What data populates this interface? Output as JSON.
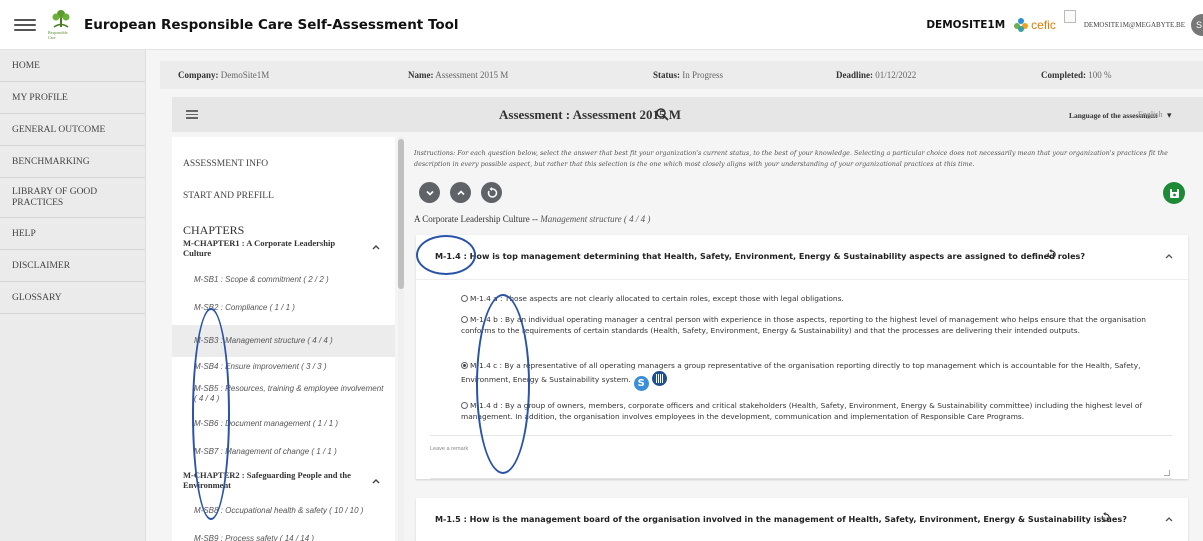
{
  "header": {
    "app_title": "European Responsible Care Self-Assessment Tool",
    "logo_caption": "Responsible Care",
    "site": "DEMOSITE1M",
    "partner_logo": "cefic",
    "email": "DEMOSITE1M@MEGABYTE.BE",
    "avatar_letter": "S"
  },
  "sidebar": {
    "items": [
      {
        "label": "HOME"
      },
      {
        "label": "MY PROFILE"
      },
      {
        "label": "GENERAL OUTCOME"
      },
      {
        "label": "BENCHMARKING"
      },
      {
        "label": "LIBRARY OF GOOD PRACTICES"
      },
      {
        "label": "HELP"
      },
      {
        "label": "DISCLAIMER"
      },
      {
        "label": "GLOSSARY"
      }
    ]
  },
  "infobar": {
    "company_label": "Company:",
    "company_value": "DemoSite1M",
    "name_label": "Name:",
    "name_value": "Assessment 2015 M",
    "status_label": "Status:",
    "status_value": "In Progress",
    "deadline_label": "Deadline:",
    "deadline_value": "01/12/2022",
    "completed_label": "Completed:",
    "completed_value": "100 %"
  },
  "assessment_bar": {
    "title": "Assessment : Assessment 2015 M",
    "language_label": "Language of the assessment",
    "language_value": "English"
  },
  "chapters_panel": {
    "assessment_info": "ASSESSMENT INFO",
    "start_prefill": "START AND PREFILL",
    "heading": "CHAPTERS",
    "chapter1": "M-CHAPTER1 : A Corporate Leadership Culture",
    "sub1": [
      {
        "label": "M-SB1 : Scope & commitment ( 2 / 2 )"
      },
      {
        "label": "M-SB2 : Compliance ( 1 / 1 )"
      },
      {
        "label": "M-SB3 : Management structure ( 4 / 4 )"
      },
      {
        "label": "M-SB4 : Ensure improvement ( 3 / 3 )"
      },
      {
        "label": "M-SB5 : Resources, training & employee involvement ( 4 / 4 )"
      },
      {
        "label": "M-SB6 : Document management ( 1 / 1 )"
      },
      {
        "label": "M-SB7 : Management of change ( 1 / 1 )"
      }
    ],
    "chapter2": "M-CHAPTER2 : Safeguarding People and the Environment",
    "sub2": [
      {
        "label": "M-SB8 : Occupational health & safety ( 10 / 10 )"
      },
      {
        "label": "M-SB9 : Process safety ( 14 / 14 )"
      }
    ]
  },
  "content": {
    "instructions": "Instructions: For each question below, select the answer that best fit your organization's current status, to the best of your knowledge. Selecting a particular choice does not necessarily mean that your organization's practices fit the description in every possible aspect, but rather that this selection is the one which most closely aligns with your understanding of your organizational practices at this time.",
    "crumb_chapter": "A Corporate Leadership Culture --",
    "crumb_section": "Management structure ( 4 / 4 )",
    "question1": {
      "title": "M-1.4 : How is top management determining that Health, Safety, Environment, Energy & Sustainability aspects are assigned to defined roles?",
      "options": [
        {
          "text": "M-1.4 a : Those aspects are not clearly allocated to certain roles, except those with legal obligations.",
          "selected": false
        },
        {
          "text": "M-1.4 b : By an individual operating manager a central person with experience in those aspects, reporting to the highest level of management who helps ensure that the organisation conforms to the requirements of certain standards (Health, Safety, Environment, Energy & Sustainability) and that the processes are delivering their intended outputs.",
          "selected": false
        },
        {
          "text": "M-1.4 c : By a representative of all operating managers a group representative of the organisation reporting directly to top management which is accountable for the Health, Safety, Environment, Energy & Sustainability system.",
          "selected": true
        },
        {
          "text": "M-1.4 d : By a group of owners, members, corporate officers and critical stakeholders (Health, Safety, Environment, Energy & Sustainability committee) including the highest level of management. In addition, the organisation involves employees in the development, communication and implementation of Responsible Care Programs.",
          "selected": false
        }
      ],
      "remark_placeholder": "Leave a remark"
    },
    "question2": {
      "title": "M-1.5 : How is the management board of the organisation involved in the management of Health, Safety, Environment, Energy & Sustainability issues?"
    }
  },
  "icons": {
    "menu": "hamburger-icon",
    "search": "search-icon",
    "expand": "chevron-down-icon",
    "collapse": "chevron-up-icon",
    "reset": "reset-icon",
    "save": "save-icon",
    "accent_green": "#1e8a38",
    "button_grey": "#5f6368"
  }
}
